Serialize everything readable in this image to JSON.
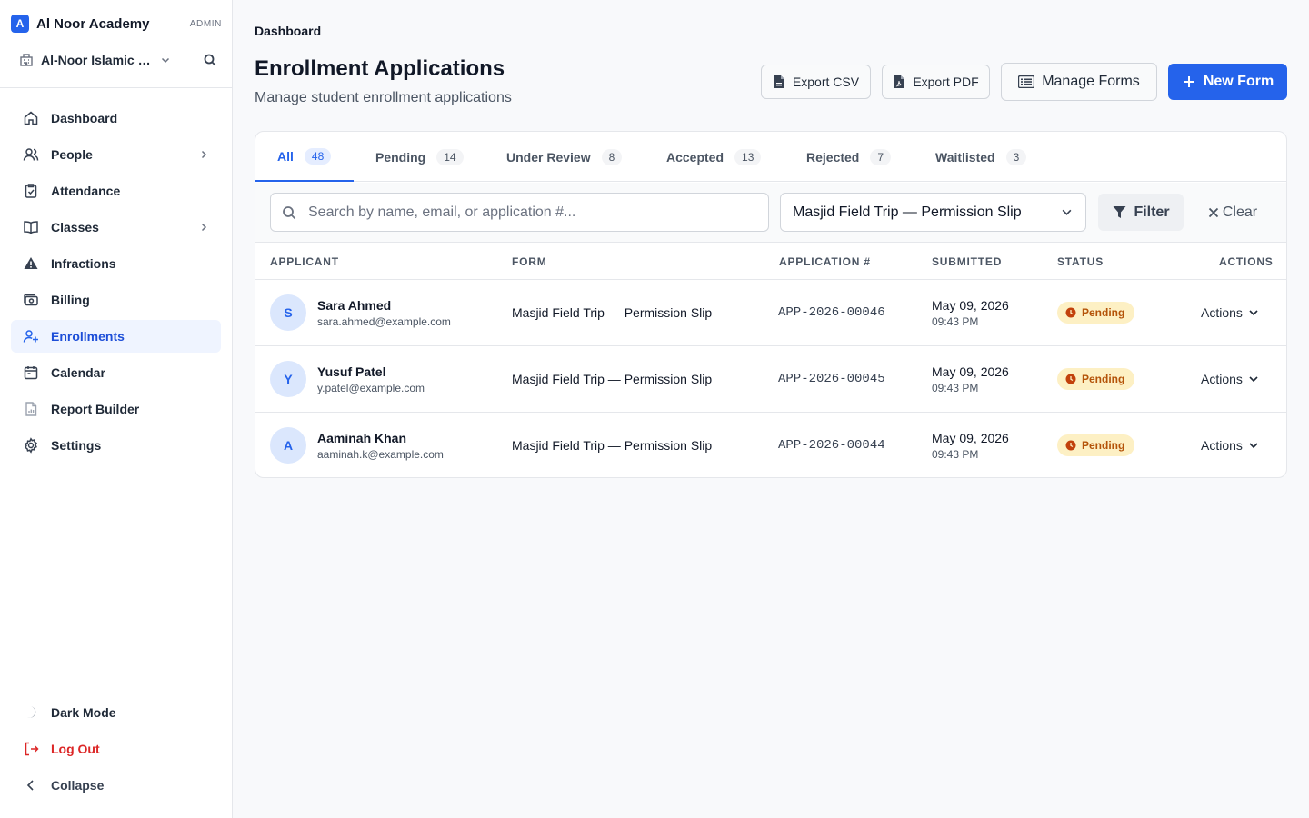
{
  "brand": {
    "logo_letter": "A",
    "name": "Al Noor Academy",
    "role": "ADMIN"
  },
  "org": {
    "name": "Al-Noor Islamic Center",
    "icon": "building-icon"
  },
  "sidebar": {
    "items": [
      {
        "label": "Dashboard",
        "icon": "home-icon"
      },
      {
        "label": "People",
        "icon": "users-icon"
      },
      {
        "label": "Attendance",
        "icon": "clipboard-check-icon"
      },
      {
        "label": "Classes",
        "icon": "book-icon"
      },
      {
        "label": "Infractions",
        "icon": "warning-icon"
      },
      {
        "label": "Billing",
        "icon": "money-icon"
      },
      {
        "label": "Enrollments",
        "icon": "user-plus-icon",
        "active": true
      },
      {
        "label": "Calendar",
        "icon": "calendar-icon"
      },
      {
        "label": "Report Builder",
        "icon": "report-icon"
      },
      {
        "label": "Settings",
        "icon": "gear-icon"
      }
    ],
    "bottom": {
      "dark_mode": "Dark Mode",
      "logout": "Log Out",
      "collapse": "Collapse"
    }
  },
  "header": {
    "breadcrumb": "Dashboard",
    "title": "Enrollment Applications",
    "subtitle": "Manage student enrollment applications",
    "export_csv": "Export CSV",
    "export_pdf": "Export PDF",
    "manage_forms": "Manage Forms",
    "new_form": "New Form"
  },
  "tabs": [
    {
      "label": "All",
      "count": "48",
      "active": true
    },
    {
      "label": "Pending",
      "count": "14"
    },
    {
      "label": "Under Review",
      "count": "8"
    },
    {
      "label": "Accepted",
      "count": "13"
    },
    {
      "label": "Rejected",
      "count": "7"
    },
    {
      "label": "Waitlisted",
      "count": "3"
    }
  ],
  "filters": {
    "search_placeholder": "Search by name, email, or application #...",
    "search_value": "",
    "form_selected": "Masjid Field Trip — Permission Slip",
    "filter_label": "Filter",
    "clear_label": "Clear"
  },
  "table": {
    "columns": [
      "APPLICANT",
      "FORM",
      "APPLICATION #",
      "SUBMITTED",
      "STATUS",
      "ACTIONS"
    ],
    "rows": [
      {
        "initial": "S",
        "name": "Sara Ahmed",
        "email": "sara.ahmed@example.com",
        "form": "Masjid Field Trip — Permission Slip",
        "app_no": "APP-2026-00046",
        "date": "May 09, 2026",
        "time": "09:43 PM",
        "status": "Pending",
        "actions": "Actions"
      },
      {
        "initial": "Y",
        "name": "Yusuf Patel",
        "email": "y.patel@example.com",
        "form": "Masjid Field Trip — Permission Slip",
        "app_no": "APP-2026-00045",
        "date": "May 09, 2026",
        "time": "09:43 PM",
        "status": "Pending",
        "actions": "Actions"
      },
      {
        "initial": "A",
        "name": "Aaminah Khan",
        "email": "aaminah.k@example.com",
        "form": "Masjid Field Trip — Permission Slip",
        "app_no": "APP-2026-00044",
        "date": "May 09, 2026",
        "time": "09:43 PM",
        "status": "Pending",
        "actions": "Actions"
      }
    ]
  },
  "colors": {
    "accent": "#2563eb",
    "active_nav_bg": "#eff4ff",
    "pending_bg": "#fdf0c4",
    "pending_text": "#b45309",
    "danger": "#dc2626"
  }
}
